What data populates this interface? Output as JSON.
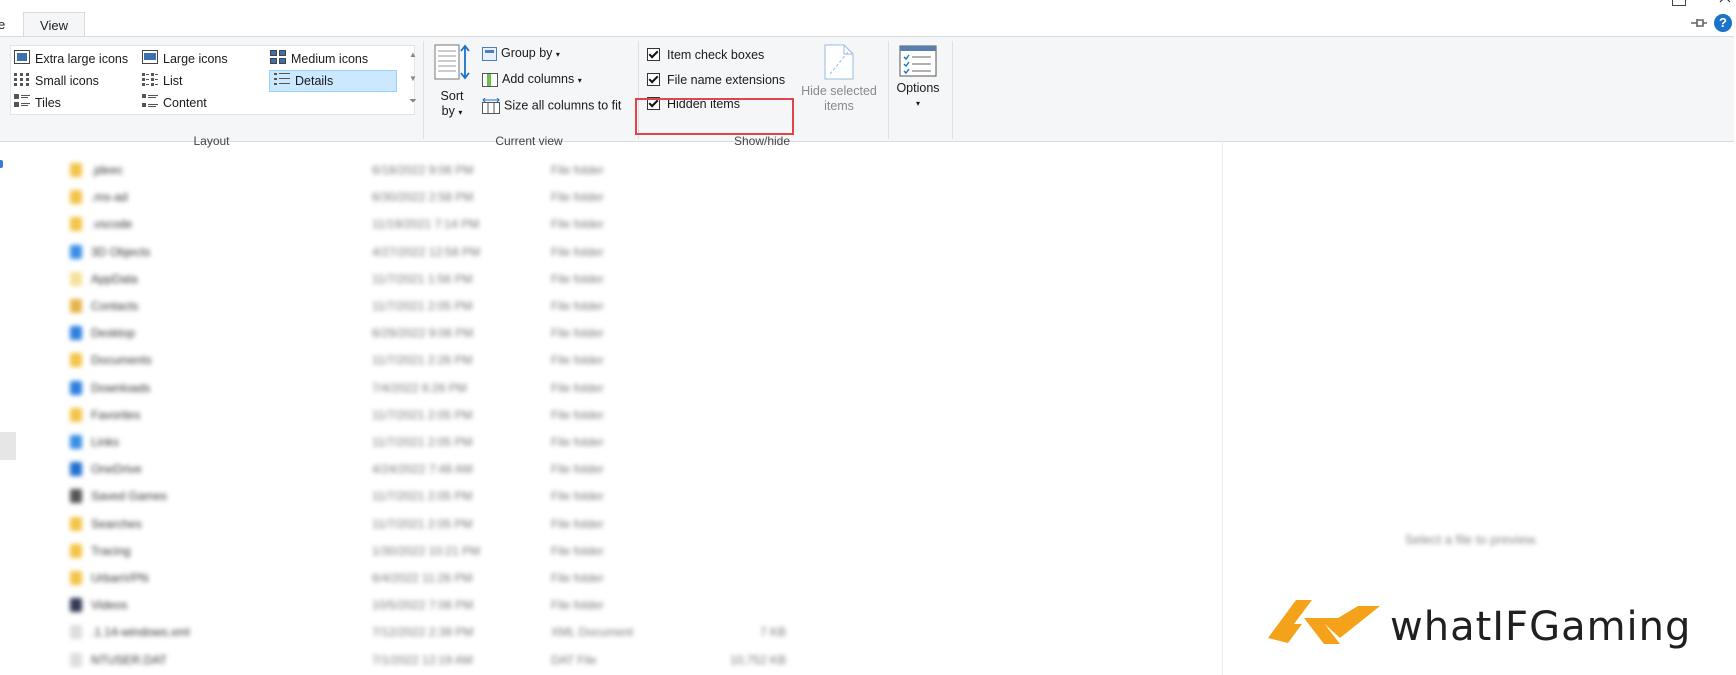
{
  "tabs": {
    "file_label": "e",
    "view_label": "View"
  },
  "layout": {
    "items": [
      {
        "label": "Extra large icons",
        "icon": "extra-large-icons-icon"
      },
      {
        "label": "Large icons",
        "icon": "large-icons-icon"
      },
      {
        "label": "Medium icons",
        "icon": "medium-icons-icon"
      },
      {
        "label": "Small icons",
        "icon": "small-icons-icon"
      },
      {
        "label": "List",
        "icon": "list-icon"
      },
      {
        "label": "Details",
        "icon": "details-icon",
        "selected": true
      },
      {
        "label": "Tiles",
        "icon": "tiles-icon"
      },
      {
        "label": "Content",
        "icon": "content-icon"
      }
    ],
    "group_label": "Layout"
  },
  "current_view": {
    "sort_by": {
      "line1": "Sort",
      "line2": "by"
    },
    "group_by": "Group by",
    "add_columns": "Add columns",
    "size_all_columns": "Size all columns to fit",
    "group_label": "Current view"
  },
  "show_hide": {
    "item_check_boxes": {
      "label": "Item check boxes",
      "checked": true
    },
    "file_name_extensions": {
      "label": "File name extensions",
      "checked": true
    },
    "hidden_items": {
      "label": "Hidden items",
      "checked": true
    },
    "hide_selected": {
      "line1": "Hide selected",
      "line2": "items"
    },
    "group_label": "Show/hide"
  },
  "options": {
    "label": "Options"
  },
  "files": [
    {
      "name": ".jdeec",
      "date": "6/18/2022 9:06 PM",
      "type": "File folder",
      "size": "",
      "icon_color": "#f3c447"
    },
    {
      "name": ".ms-ad",
      "date": "6/30/2022 2:58 PM",
      "type": "File folder",
      "size": "",
      "icon_color": "#f3c447"
    },
    {
      "name": ".vscode",
      "date": "11/19/2021 7:14 PM",
      "type": "File folder",
      "size": "",
      "icon_color": "#f3c447"
    },
    {
      "name": "3D Objects",
      "date": "4/27/2022 12:58 PM",
      "type": "File folder",
      "size": "",
      "icon_color": "#3a8ee6"
    },
    {
      "name": "AppData",
      "date": "11/7/2021 1:56 PM",
      "type": "File folder",
      "size": "",
      "icon_color": "#f7e09a"
    },
    {
      "name": "Contacts",
      "date": "11/7/2021 2:05 PM",
      "type": "File folder",
      "size": "",
      "icon_color": "#e7b44a"
    },
    {
      "name": "Desktop",
      "date": "6/29/2022 9:06 PM",
      "type": "File folder",
      "size": "",
      "icon_color": "#2c7fe0"
    },
    {
      "name": "Documents",
      "date": "11/7/2021 2:26 PM",
      "type": "File folder",
      "size": "",
      "icon_color": "#f3c447"
    },
    {
      "name": "Downloads",
      "date": "7/4/2022 6:26 PM",
      "type": "File folder",
      "size": "",
      "icon_color": "#2c7fe0"
    },
    {
      "name": "Favorites",
      "date": "11/7/2021 2:05 PM",
      "type": "File folder",
      "size": "",
      "icon_color": "#f3c447"
    },
    {
      "name": "Links",
      "date": "11/7/2021 2:05 PM",
      "type": "File folder",
      "size": "",
      "icon_color": "#3a8ee6"
    },
    {
      "name": "OneDrive",
      "date": "4/24/2022 7:48 AM",
      "type": "File folder",
      "size": "",
      "icon_color": "#1e6fd0"
    },
    {
      "name": "Saved Games",
      "date": "11/7/2021 2:05 PM",
      "type": "File folder",
      "size": "",
      "icon_color": "#555555"
    },
    {
      "name": "Searches",
      "date": "11/7/2021 2:05 PM",
      "type": "File folder",
      "size": "",
      "icon_color": "#f3c447"
    },
    {
      "name": "Tracing",
      "date": "1/30/2022 10:21 PM",
      "type": "File folder",
      "size": "",
      "icon_color": "#f3c447"
    },
    {
      "name": "UrbanVPN",
      "date": "6/4/2022 11:26 PM",
      "type": "File folder",
      "size": "",
      "icon_color": "#f3c447"
    },
    {
      "name": "Videos",
      "date": "10/5/2022 7:06 PM",
      "type": "File folder",
      "size": "",
      "icon_color": "#333a55"
    },
    {
      "name": ".1.14-windows.xml",
      "date": "7/12/2022 2:39 PM",
      "type": "XML Document",
      "size": "7 KB",
      "icon_color": "#dddddd"
    },
    {
      "name": "NTUSER.DAT",
      "date": "7/1/2022 12:19 AM",
      "type": "DAT File",
      "size": "10,752 KB",
      "icon_color": "#dddddd"
    }
  ],
  "preview": {
    "empty_text": "Select a file to preview."
  },
  "watermark": {
    "text": "whatIFGaming"
  },
  "colors": {
    "accent": "#1a73c8",
    "highlight": "#e0454b",
    "selection": "#cce8ff",
    "watermark_orange": "#f5a21b"
  }
}
